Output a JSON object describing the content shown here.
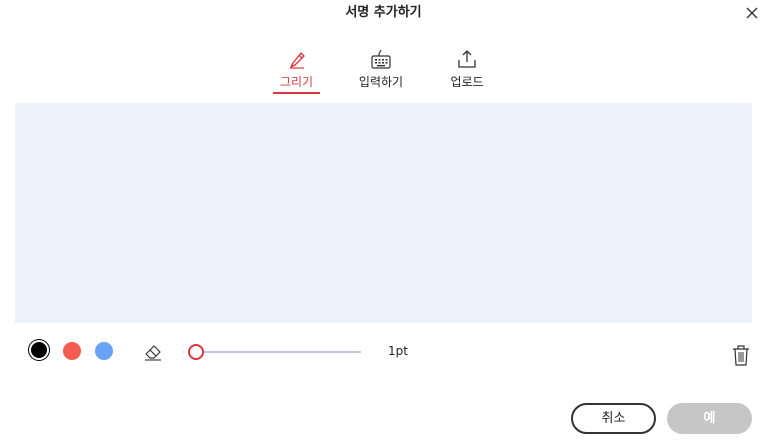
{
  "dialog": {
    "title": "서명 추가하기",
    "close_icon": "close-icon"
  },
  "tabs": [
    {
      "label": "그리기",
      "icon": "pen-icon",
      "active": true
    },
    {
      "label": "입력하기",
      "icon": "keyboard-icon",
      "active": false
    },
    {
      "label": "업로드",
      "icon": "upload-icon",
      "active": false
    }
  ],
  "toolbar": {
    "colors": [
      "#000000",
      "#f25b4f",
      "#6aa3f5"
    ],
    "selected_color": "#000000",
    "eraser_icon": "eraser-icon",
    "pen_size": 1,
    "size_label": "1pt",
    "trash_icon": "trash-icon"
  },
  "footer": {
    "cancel_label": "취소",
    "ok_label": "예"
  },
  "accent_color": "#d9363e"
}
